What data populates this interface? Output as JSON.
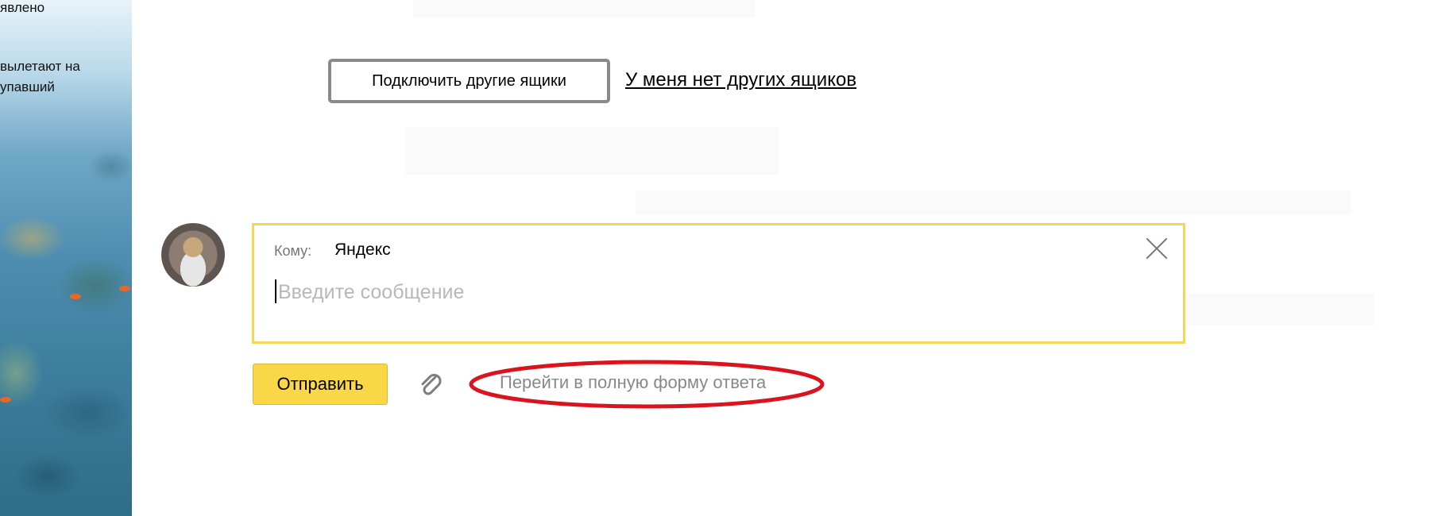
{
  "sidebar": {
    "news_lines": [
      "явлено",
      "вылетают на",
      "упавший"
    ]
  },
  "mailbox": {
    "connect_button": "Подключить другие ящики",
    "no_other_link": "У меня нет других ящиков"
  },
  "compose": {
    "to_label": "Кому:",
    "to_value": "Яндекс",
    "message_placeholder": "Введите сообщение",
    "close_icon": "close-icon"
  },
  "actions": {
    "send_label": "Отправить",
    "attach_icon": "paperclip-icon",
    "full_form_link": "Перейти в полную форму ответа"
  },
  "colors": {
    "send_button": "#f9d746",
    "compose_border": "#f5d65a",
    "highlight_ellipse": "#d9141e"
  }
}
